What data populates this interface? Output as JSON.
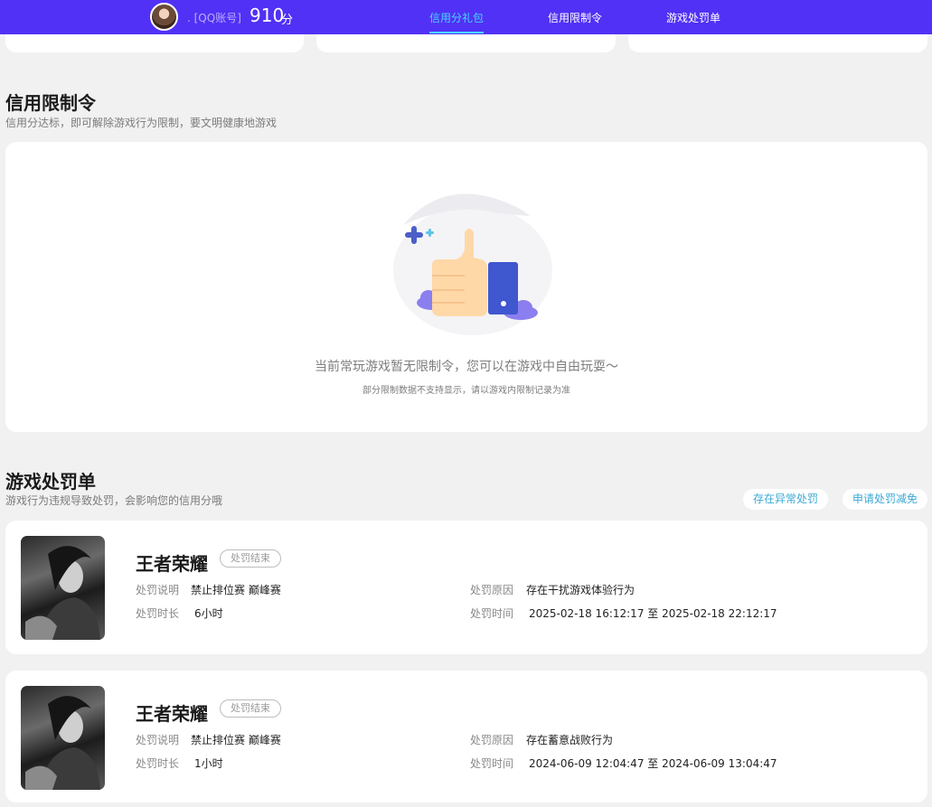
{
  "header": {
    "account_label": ". [QQ账号]",
    "score": "910",
    "score_unit": "分",
    "tabs": [
      {
        "label": "信用分礼包",
        "active": true
      },
      {
        "label": "信用限制令",
        "active": false
      },
      {
        "label": "游戏处罚单",
        "active": false
      }
    ]
  },
  "restriction": {
    "title": "信用限制令",
    "subtitle": "信用分达标，即可解除游戏行为限制，要文明健康地游戏",
    "empty_message": "当前常玩游戏暂无限制令，您可以在游戏中自由玩耍～",
    "empty_note": "部分限制数据不支持显示，请以游戏内限制记录为准"
  },
  "penalty": {
    "title": "游戏处罚单",
    "subtitle": "游戏行为违规导致处罚，会影响您的信用分哦",
    "actions": [
      "存在异常处罚",
      "申请处罚减免"
    ],
    "labels": {
      "desc": "处罚说明",
      "reason": "处罚原因",
      "duration": "处罚时长",
      "time": "处罚时间"
    },
    "records": [
      {
        "game": "王者荣耀",
        "status": "处罚结束",
        "desc": "禁止排位赛 巅峰赛",
        "reason": "存在干扰游戏体验行为",
        "duration": "6小时",
        "time": "2025-02-18 16:12:17 至 2025-02-18 22:12:17"
      },
      {
        "game": "王者荣耀",
        "status": "处罚结束",
        "desc": "禁止排位赛 巅峰赛",
        "reason": "存在蓄意战败行为",
        "duration": "1小时",
        "time": "2024-06-09 12:04:47 至 2024-06-09 13:04:47"
      }
    ]
  },
  "colors": {
    "brand": "#5131f5",
    "tab_active": "#49d5ff",
    "link": "#3aa9d5"
  }
}
